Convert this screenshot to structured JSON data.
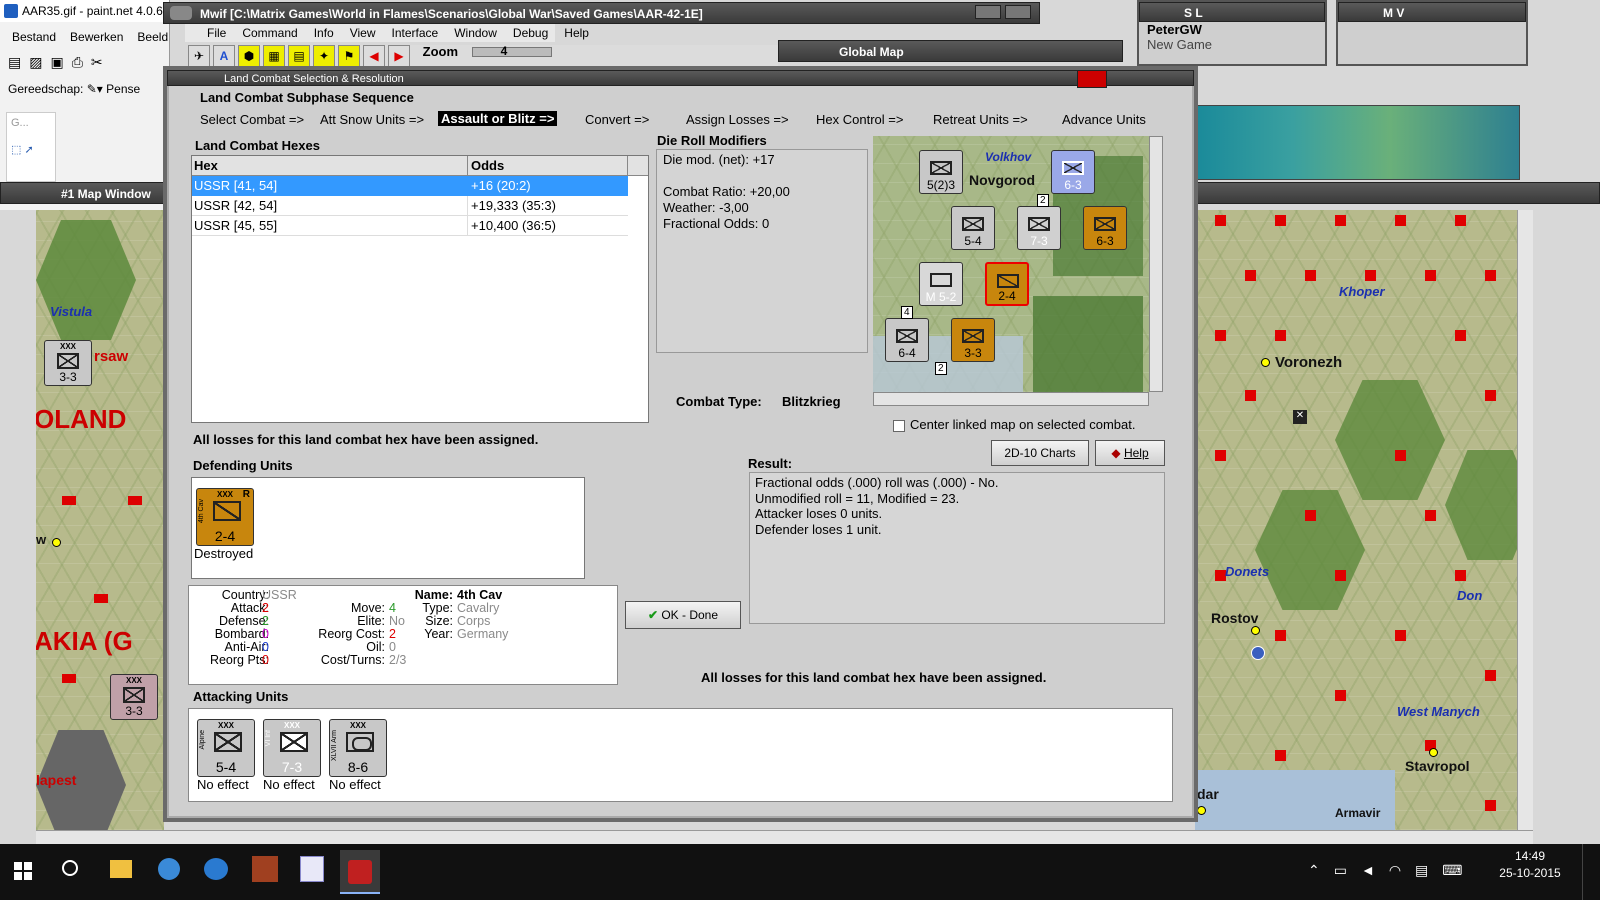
{
  "paint": {
    "title": "AAR35.gif - paint.net 4.0.6",
    "menu": [
      "Bestand",
      "Bewerken",
      "Beeld"
    ],
    "tool_label": "Gereedschap:",
    "brush_label": "Pense"
  },
  "mwif": {
    "title": "Mwif [C:\\Matrix Games\\World in Flames\\Scenarios\\Global War\\Saved Games\\AAR-42-1E]",
    "menu": [
      "File",
      "Command",
      "Info",
      "View",
      "Interface",
      "Window",
      "Debug",
      "Help"
    ],
    "zoom_label": "Zoom",
    "zoom_value": "4"
  },
  "global_map": {
    "title": "Global Map"
  },
  "sl": {
    "title": "S L",
    "player": "PeterGW",
    "game": "New Game"
  },
  "mv": {
    "title": "M V"
  },
  "map_window": {
    "title": "#1 Map Window"
  },
  "left_map": {
    "labels": {
      "vistula": "Vistula",
      "warsaw": "rsaw",
      "poland": "OLAND",
      "w": "w",
      "slovakia": "AKIA (G",
      "budapest": "lapest"
    },
    "counters": [
      {
        "value": "3-3",
        "size": "XXX"
      },
      {
        "value": "3-3",
        "size": "XXX"
      }
    ]
  },
  "right_map": {
    "labels": {
      "khoper": "Khoper",
      "voronezh": "Voronezh",
      "donets": "Donets",
      "don": "Don",
      "rostov": "Rostov",
      "west_manych": "West Manych",
      "stavropol": "Stavropol",
      "dar": "dar",
      "armavir": "Armavir"
    }
  },
  "dialog": {
    "title": "Land Combat Selection & Resolution",
    "sequence_title": "Land Combat Subphase Sequence",
    "sequence": [
      {
        "label": "Select Combat =>"
      },
      {
        "label": "Att Snow Units =>"
      },
      {
        "label": "Assault or Blitz =>",
        "active": true
      },
      {
        "label": "Convert =>"
      },
      {
        "label": "Assign Losses =>"
      },
      {
        "label": "Hex Control =>"
      },
      {
        "label": "Retreat Units =>"
      },
      {
        "label": "Advance Units"
      }
    ],
    "hexes": {
      "title": "Land Combat Hexes",
      "columns": [
        "Hex",
        "Odds"
      ],
      "rows": [
        {
          "hex": "USSR [41, 54]",
          "odds": "+16 (20:2)",
          "selected": true
        },
        {
          "hex": "USSR [42, 54]",
          "odds": "+19,333 (35:3)"
        },
        {
          "hex": "USSR [45, 55]",
          "odds": "+10,400 (36:5)"
        }
      ]
    },
    "modifiers": {
      "title": "Die Roll Modifiers",
      "net": "Die mod. (net): +17",
      "ratio": "Combat Ratio: +20,00",
      "weather": "Weather: -3,00",
      "fractional": "Fractional Odds: 0"
    },
    "combat_type_label": "Combat Type:",
    "combat_type": "Blitzkrieg",
    "mini_map": {
      "novgorod": "Novgorod",
      "volkhov": "Volkhov",
      "counters": [
        "5(2)3",
        "6-3",
        "5-4",
        "7-3",
        "6-3",
        "M 5-2",
        "2-4",
        "6-4",
        "3-3"
      ],
      "stack_numbers": [
        "2",
        "4",
        "2"
      ]
    },
    "center_linked": "Center linked map on selected combat.",
    "charts_button": "2D-10 Charts",
    "help_button": "Help",
    "losses_msg": "All losses for this land combat hex have been assigned.",
    "defending": {
      "title": "Defending Units",
      "unit": {
        "value": "2-4",
        "size": "XXX",
        "name": "4th Cav",
        "reserve": "R",
        "status": "Destroyed"
      }
    },
    "unit_info": {
      "country_label": "Country:",
      "country": "USSR",
      "attack_label": "Attack:",
      "attack": "2",
      "defense_label": "Defense:",
      "defense": "2",
      "bombard_label": "Bombard:",
      "bombard": "0",
      "antiair_label": "Anti-Air:",
      "antiair": "0",
      "reorg_label": "Reorg Pts:",
      "reorg": "0",
      "move_label": "Move:",
      "move": "4",
      "elite_label": "Elite:",
      "elite": "No",
      "reorg_cost_label": "Reorg Cost:",
      "reorg_cost": "2",
      "oil_label": "Oil:",
      "oil": "0",
      "cost_label": "Cost/Turns:",
      "cost": "2/3",
      "name_label": "Name:",
      "name": "4th Cav",
      "type_label": "Type:",
      "type": "Cavalry",
      "size_label": "Size:",
      "size": "Corps",
      "year_label": "Year:",
      "year": "Germany"
    },
    "ok_button": "OK - Done",
    "result": {
      "title": "Result:",
      "lines": [
        "Fractional odds (.000) roll was (.000)  - No.",
        "Unmodified roll = 11, Modified = 23.",
        "Attacker loses 0 units.",
        "Defender loses 1 unit."
      ]
    },
    "losses_msg2": "All losses for this land combat hex have been assigned.",
    "attacking": {
      "title": "Attacking Units",
      "units": [
        {
          "value": "5-4",
          "size": "XXX",
          "name": "Alpine",
          "status": "No effect"
        },
        {
          "value": "7-3",
          "size": "XXX",
          "name": "VI Inf",
          "status": "No effect"
        },
        {
          "value": "8-6",
          "size": "XXX",
          "name": "XLVII Arm",
          "status": "No effect"
        }
      ]
    }
  },
  "taskbar": {
    "time": "14:49",
    "date": "25-10-2015",
    "search_icon": "search-icon"
  },
  "colors": {
    "selected_row": "#3399ff",
    "soviet_counter": "#c8860d",
    "german_counter": "#c8c8c8",
    "title_bar": "#3a3a3a"
  }
}
